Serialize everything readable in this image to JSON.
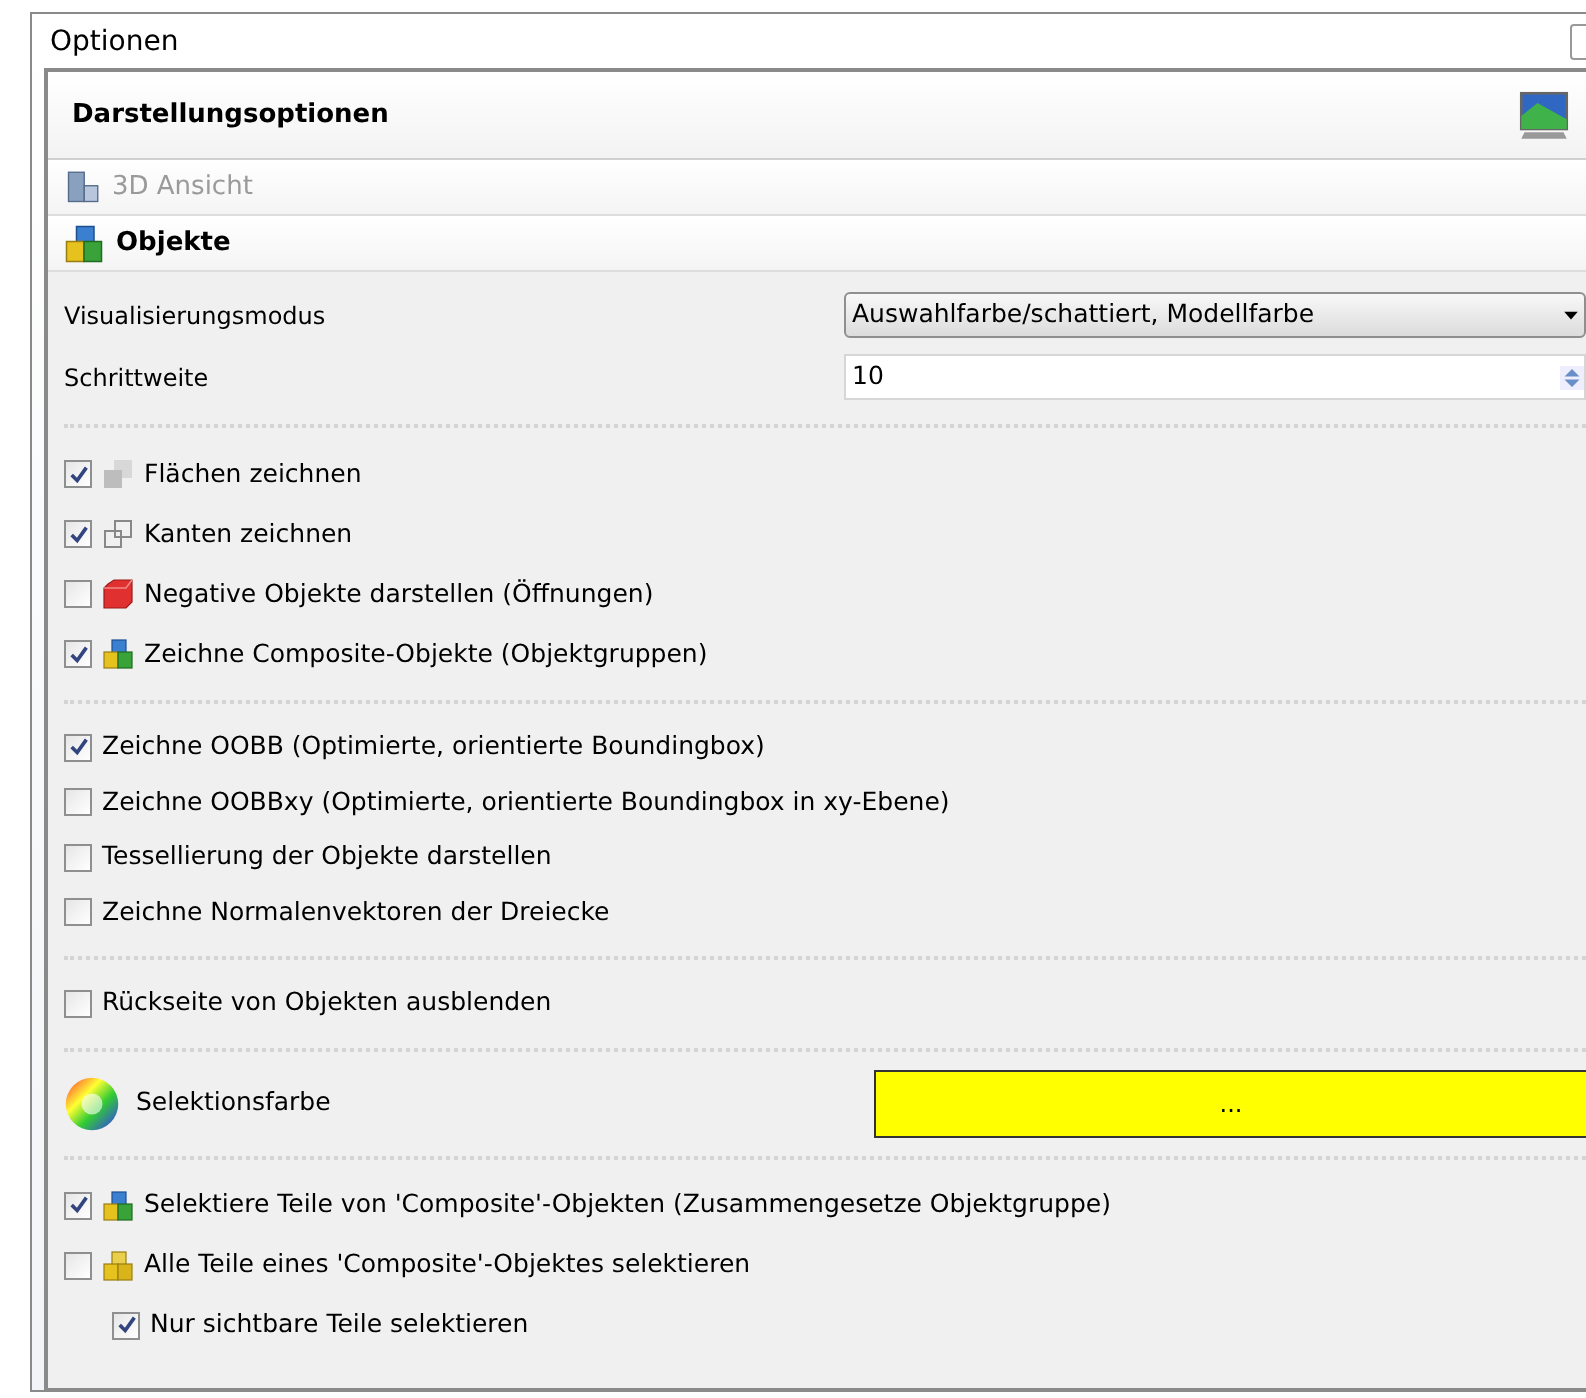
{
  "window": {
    "title": "Optionen"
  },
  "panel": {
    "title": "Darstellungsoptionen"
  },
  "sections": [
    {
      "label": "3D Ansicht",
      "disabled": true
    },
    {
      "label": "Objekte",
      "disabled": false
    }
  ],
  "fields": [
    {
      "kind": "select",
      "label": "Visualisierungsmodus",
      "value": "Auswahlfarbe/schattiert, Modellfarbe"
    },
    {
      "kind": "spinner",
      "label": "Schrittweite",
      "value": "10"
    }
  ],
  "groups": [
    {
      "items": [
        {
          "label": "Flächen zeichnen",
          "checked": true
        },
        {
          "label": "Kanten zeichnen",
          "checked": true
        },
        {
          "label": "Negative Objekte darstellen (Öffnungen)",
          "checked": false
        },
        {
          "label": "Zeichne Composite-Objekte (Objektgruppen)",
          "checked": true
        }
      ]
    },
    {
      "items": [
        {
          "label": "Zeichne OOBB (Optimierte, orientierte Boundingbox)",
          "checked": true
        },
        {
          "label": "Zeichne OOBBxy (Optimierte, orientierte Boundingbox in xy-Ebene)",
          "checked": false
        },
        {
          "label": "Tessellierung der Objekte darstellen",
          "checked": false
        },
        {
          "label": "Zeichne Normalenvektoren der Dreiecke",
          "checked": false
        }
      ]
    },
    {
      "items": [
        {
          "label": "Rückseite von Objekten ausblenden",
          "checked": false
        }
      ]
    }
  ],
  "selection_color": {
    "label": "Selektionsfarbe",
    "button": "...",
    "color": "#ffff00"
  },
  "selection_items": [
    {
      "label": "Selektiere Teile von 'Composite'-Objekten (Zusammengesetze Objektgruppe)",
      "checked": true
    },
    {
      "label": "Alle Teile eines 'Composite'-Objektes selektieren",
      "checked": false,
      "children": [
        {
          "label": "Nur sichtbare Teile selektieren",
          "checked": true
        }
      ]
    }
  ]
}
